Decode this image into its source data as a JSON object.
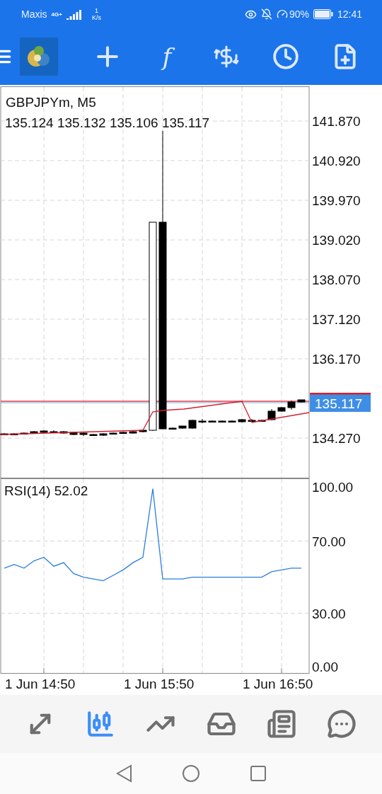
{
  "status_bar": {
    "carrier": "Maxis",
    "network": "4G+",
    "speed_value": "1",
    "speed_unit": "K/s",
    "battery": "90%",
    "time": "12:41"
  },
  "toolbar": {
    "function_glyph": "f"
  },
  "price_chart": {
    "symbol": "GBPJPYm, M5",
    "ohlc": "135.124 135.132 135.106 135.117",
    "price_labels": [
      "141.870",
      "140.920",
      "139.970",
      "139.020",
      "138.070",
      "137.120",
      "136.170",
      "134.270"
    ],
    "bid_tag": "135.117"
  },
  "rsi": {
    "chart_data": {
      "type": "line",
      "title": "RSI(14) 52.02",
      "categories": [
        null,
        null,
        null,
        null,
        "1 Jun 14:50",
        null,
        null,
        null,
        null,
        null,
        null,
        null,
        null,
        null,
        null,
        null,
        "1 Jun 15:50",
        null,
        null,
        null,
        null,
        null,
        null,
        null,
        null,
        null,
        null,
        null,
        "1 Jun 16:50",
        null,
        null
      ],
      "ylim": [
        -3.5,
        104.7
      ],
      "yticks": [
        {
          "value": 0,
          "label": "0.00"
        },
        {
          "value": 30,
          "label": "30.00"
        },
        {
          "value": 70,
          "label": "70.00"
        },
        {
          "value": 100,
          "label": "100.00"
        }
      ],
      "series": [
        {
          "color": "#2b7de0",
          "values": [
            55,
            57,
            55,
            59,
            61,
            56,
            58,
            52,
            50,
            49,
            48,
            51,
            54,
            58,
            61,
            99,
            49,
            49,
            49,
            50,
            50,
            50,
            50,
            50,
            50,
            50,
            50,
            53,
            54,
            55,
            55
          ]
        }
      ]
    }
  },
  "bottom_nav": [
    {
      "kind": "trade",
      "selected": false
    },
    {
      "kind": "chart",
      "selected": true
    },
    {
      "kind": "history",
      "selected": false
    },
    {
      "kind": "inbox",
      "selected": false
    },
    {
      "kind": "news",
      "selected": false
    },
    {
      "kind": "chat",
      "selected": false
    }
  ]
}
